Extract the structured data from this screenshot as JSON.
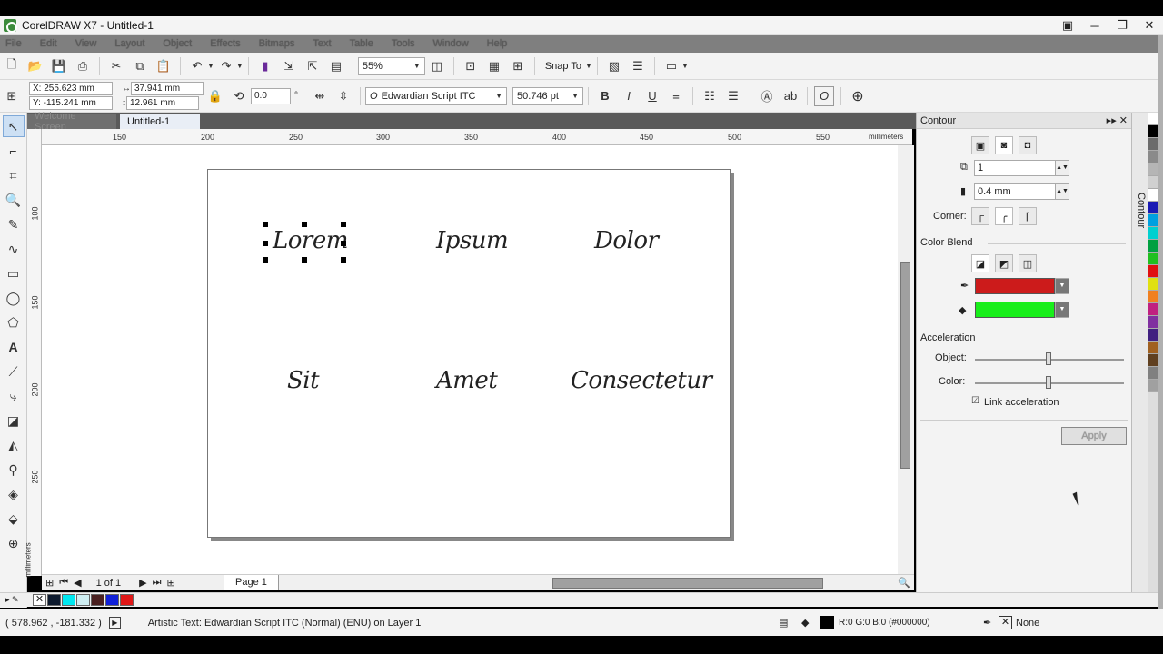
{
  "window": {
    "title": "CorelDRAW X7 - Untitled-1"
  },
  "menu": [
    "File",
    "Edit",
    "View",
    "Layout",
    "Object",
    "Effects",
    "Bitmaps",
    "Text",
    "Table",
    "Tools",
    "Window",
    "Help"
  ],
  "standard_toolbar": {
    "zoom": "55%",
    "snap_to": "Snap To"
  },
  "property_bar": {
    "x": "X: 255.623 mm",
    "y": "Y: -115.241 mm",
    "width": "37.941 mm",
    "height": "12.961 mm",
    "angle": "0.0",
    "angle_unit": "°",
    "font": "Edwardian Script ITC",
    "font_size": "50.746 pt"
  },
  "doc_tabs": {
    "welcome": "Welcome Screen",
    "active": "Untitled-1"
  },
  "ruler": {
    "units": "millimeters",
    "h_ticks": [
      "150",
      "200",
      "250",
      "300",
      "350",
      "400",
      "450",
      "500",
      "550"
    ],
    "v_ticks": [
      "100",
      "150",
      "200",
      "250"
    ]
  },
  "page_text": [
    "Lorem",
    "Ipsum",
    "Dolor",
    "Sit",
    "Amet",
    "Consectetur"
  ],
  "page_nav": {
    "counter": "1 of 1",
    "page_tab": "Page 1"
  },
  "docker": {
    "title": "Contour",
    "steps": "1",
    "offset": "0.4 mm",
    "corner_label": "Corner:",
    "color_blend_label": "Color Blend",
    "outline_color": "#cc1b1b",
    "fill_color": "#18ee1a",
    "acceleration_label": "Acceleration",
    "object_label": "Object:",
    "color_label": "Color:",
    "link_label": "Link acceleration",
    "apply_label": "Apply",
    "vertical_tab": "Contour"
  },
  "doc_palette": [
    "#0d1a2e",
    "#00e8f0",
    "#cfeef2",
    "#4a2020",
    "#1020d8",
    "#e01818"
  ],
  "palette": [
    "#ffffff",
    "#000000",
    "#6b6b6b",
    "#8a8a8a",
    "#b5b5b5",
    "#d0d0d0",
    "#ffffff",
    "#1a1ab4",
    "#00a0e0",
    "#00d0d0",
    "#00a040",
    "#20c020",
    "#e01010",
    "#e0e010",
    "#f08020",
    "#c02080",
    "#8030a0",
    "#402080",
    "#a06020",
    "#604020",
    "#808080",
    "#a0a0a0"
  ],
  "status": {
    "coords": "( 578.962 , -181.332 )",
    "info": "Artistic Text: Edwardian Script ITC (Normal) (ENU) on Layer 1",
    "fill_info": "R:0 G:0 B:0 (#000000)",
    "outline_info": "None"
  }
}
